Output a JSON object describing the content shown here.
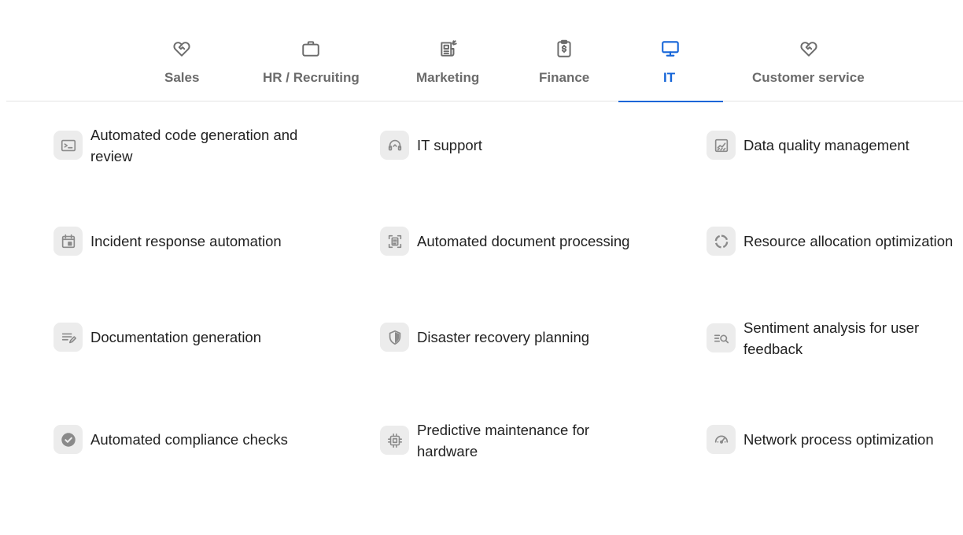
{
  "tabs": [
    {
      "label": "Sales",
      "icon": "heart-handshake-icon"
    },
    {
      "label": "HR / Recruiting",
      "icon": "briefcase-icon"
    },
    {
      "label": "Marketing",
      "icon": "newspaper-icon"
    },
    {
      "label": "Finance",
      "icon": "clipboard-dollar-icon"
    },
    {
      "label": "IT",
      "icon": "monitor-icon",
      "active": true
    },
    {
      "label": "Customer service",
      "icon": "heart-handshake-icon"
    }
  ],
  "colors": {
    "accent": "#1565d8",
    "tab_inactive": "#6b6b6b",
    "icon_bg": "#ececec",
    "icon_fg": "#8a8a8a"
  },
  "items": [
    {
      "label": "Automated code generation and review",
      "icon": "terminal-icon"
    },
    {
      "label": "IT support",
      "icon": "headset-icon"
    },
    {
      "label": "Data quality management",
      "icon": "chart-icon"
    },
    {
      "label": "Incident response automation",
      "icon": "calendar-icon"
    },
    {
      "label": "Automated document processing",
      "icon": "document-scan-icon"
    },
    {
      "label": "Resource allocation optimization",
      "icon": "donut-chart-icon"
    },
    {
      "label": "Documentation generation",
      "icon": "edit-notes-icon"
    },
    {
      "label": "Disaster recovery planning",
      "icon": "shield-icon"
    },
    {
      "label": "Sentiment analysis for user feedback",
      "icon": "search-list-icon"
    },
    {
      "label": "Automated compliance checks",
      "icon": "check-circle-icon"
    },
    {
      "label": "Predictive maintenance for hardware",
      "icon": "cpu-chip-icon"
    },
    {
      "label": "Network process optimization",
      "icon": "speedometer-icon"
    }
  ]
}
